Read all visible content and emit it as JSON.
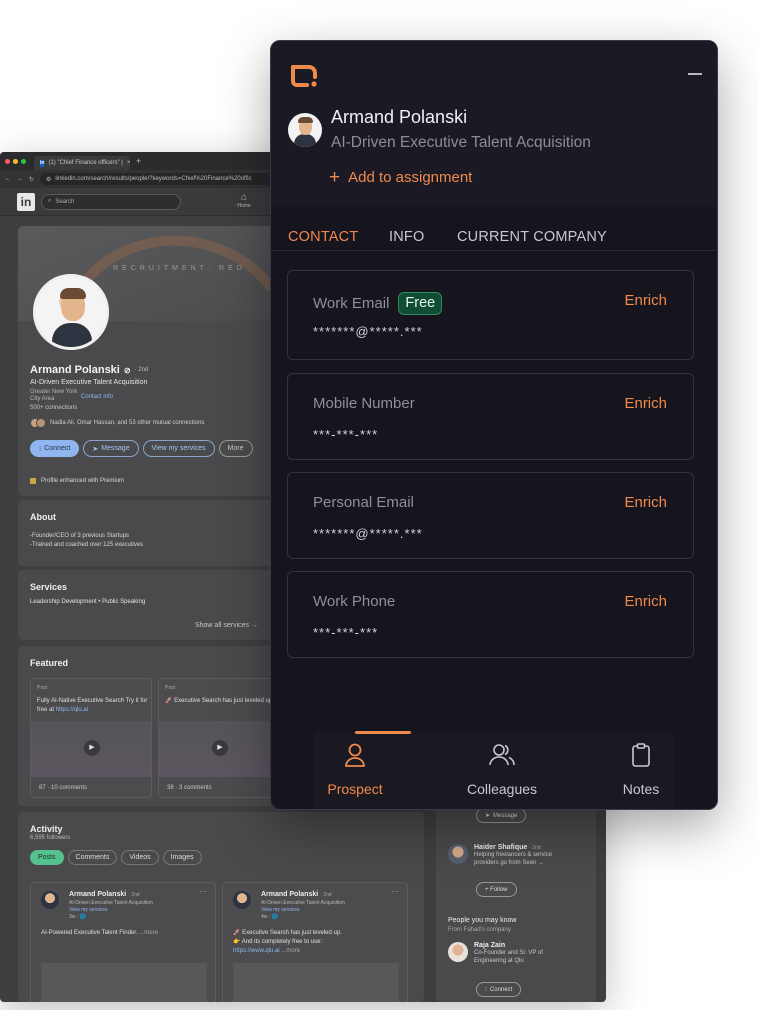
{
  "browser": {
    "tab_title": "(1) \"Chief Finance officers\" |",
    "tab_close": "×",
    "new_tab": "+",
    "url": "linkedin.com/search/results/people/?keywords=Chief%20Finance%20offic",
    "linkedin_logo": "in",
    "search_placeholder": "Search",
    "home_label": "Home"
  },
  "linkedin_profile": {
    "banner_text": "RECRUITMENT. RED",
    "name": "Armand Polanski",
    "degree": "· 2nd",
    "headline": "AI-Driven Executive Talent Acquisition",
    "location": "Greater New York City Area",
    "contact_info": "Contact info",
    "connections": "500+ connections",
    "mutual": "Nadia Ali, Omar Hassan, and 53 other mutual connections",
    "buttons": {
      "connect": "Connect",
      "message": "Message",
      "services": "View my services",
      "more": "More"
    },
    "premium": "Profile enhanced with Premium"
  },
  "about": {
    "title": "About",
    "line1": "-Founder/CEO of 3 previous Startups",
    "line2": "-Trained and coached over 125 executives"
  },
  "services": {
    "title": "Services",
    "text": "Leadership Development • Public Speaking",
    "show_all": "Show all services →"
  },
  "featured": {
    "title": "Featured",
    "items": [
      {
        "label": "Post",
        "text": "Fully AI-Native Executive Search Try it for free at",
        "link": "https://qlu.ai",
        "meta": "87 · 10 comments"
      },
      {
        "label": "Post",
        "text": "🚀 Executive Search has just leveled up.",
        "link": "",
        "meta": "38 · 3 comments"
      }
    ]
  },
  "activity": {
    "title": "Activity",
    "followers": "6,595 followers",
    "tabs": [
      "Posts",
      "Comments",
      "Videos",
      "Images"
    ],
    "posts": [
      {
        "name": "Armand Polanski",
        "degree": "· 2nd",
        "headline": "AI-Driven Executive Talent Acquisition",
        "link": "View my services",
        "time": "3w · 🌐",
        "body": "AI-Powered Executive Talent Finder.",
        "more": "...more"
      },
      {
        "name": "Armand Polanski",
        "degree": "· 2nd",
        "headline": "AI-Driven Executive Talent Acquisition",
        "link": "View my services",
        "time": "4w · 🌐",
        "body1": "🚀 Executive Search has just leveled up.",
        "body2": "👉 And its completely free to use:",
        "body_link": "https://www.qlu.ai",
        "more": "...more"
      }
    ]
  },
  "sidebar": {
    "message_button": "Message",
    "person1": {
      "name": "Haider Shafique",
      "degree": "· 2nd",
      "desc": "Helping freelancers & service providers go from Seen →",
      "button": "+ Follow"
    },
    "pymk_title": "People you may know",
    "pymk_sub": "From Fahad's company",
    "person2": {
      "name": "Raja Zain",
      "desc": "Co-Founder and Sr. VP of Engineering at Qlu",
      "button": "Connect"
    }
  },
  "panel": {
    "name": "Armand Polanski",
    "headline": "AI-Driven Executive Talent Acquisition",
    "add_label": "Add to assignment",
    "tabs": [
      "CONTACT",
      "INFO",
      "CURRENT COMPANY"
    ],
    "active_tab": "CONTACT",
    "accent_color": "#f08a4b",
    "fields": [
      {
        "label": "Work Email",
        "badge": "Free",
        "action": "Enrich",
        "value": "*******@*****.***"
      },
      {
        "label": "Mobile Number",
        "badge": "",
        "action": "Enrich",
        "value": "***-***-***"
      },
      {
        "label": "Personal Email",
        "badge": "",
        "action": "Enrich",
        "value": "*******@*****.***"
      },
      {
        "label": "Work Phone",
        "badge": "",
        "action": "Enrich",
        "value": "***-***-***"
      }
    ],
    "bottom_nav": [
      {
        "label": "Prospect",
        "icon": "person-icon",
        "active": true
      },
      {
        "label": "Colleagues",
        "icon": "people-icon",
        "active": false
      },
      {
        "label": "Notes",
        "icon": "clipboard-icon",
        "active": false
      }
    ]
  }
}
